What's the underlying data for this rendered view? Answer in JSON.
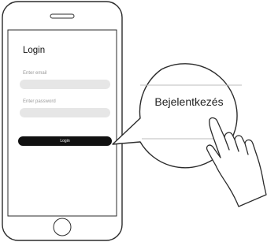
{
  "phone_screen": {
    "title": "Login",
    "email_label": "Enter email",
    "password_label": "Enter password",
    "login_button": "Login"
  },
  "magnifier": {
    "text": "Bejelentkezés"
  },
  "icons": [
    "phone-outline",
    "speaker-slot-icon",
    "home-button-icon",
    "magnifier-bubble",
    "hand-pointer-icon"
  ],
  "colors": {
    "outline": "#2b2b2b",
    "field_fill": "#e6e6e6",
    "button_fill": "#111111",
    "label_gray": "#9a9a9a"
  }
}
